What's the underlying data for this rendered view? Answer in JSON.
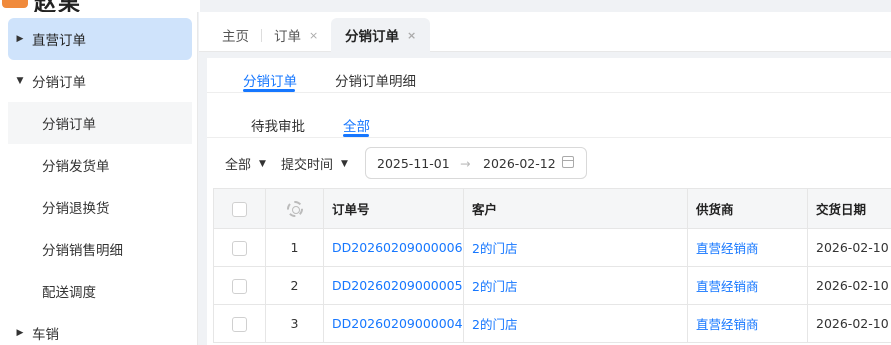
{
  "logo": {
    "text": "赵果"
  },
  "sidebar": {
    "items": [
      {
        "label": "直营订单"
      },
      {
        "label": "分销订单"
      },
      {
        "label": "分销订单"
      },
      {
        "label": "分销发货单"
      },
      {
        "label": "分销退换货"
      },
      {
        "label": "分销销售明细"
      },
      {
        "label": "配送调度"
      },
      {
        "label": "车销"
      }
    ]
  },
  "tabs": {
    "home": "主页",
    "orders": "订单",
    "dist_orders": "分销订单",
    "close": "×"
  },
  "subtabs": {
    "dist_orders": "分销订单",
    "dist_order_detail": "分销订单明细"
  },
  "status_tabs": {
    "pending": "待我审批",
    "all": "全部"
  },
  "filters": {
    "scope": "全部",
    "time_field": "提交时间",
    "date_start": "2025-11-01",
    "date_sep": "→",
    "date_end": "2026-02-12"
  },
  "table": {
    "columns": [
      "订单号",
      "客户",
      "供货商",
      "交货日期"
    ],
    "rows": [
      {
        "index": "1",
        "order_no": "DD20260209000006",
        "customer": "2的门店",
        "supplier": "直营经销商",
        "delivery_date": "2026-02-10"
      },
      {
        "index": "2",
        "order_no": "DD20260209000005",
        "customer": "2的门店",
        "supplier": "直营经销商",
        "delivery_date": "2026-02-10"
      },
      {
        "index": "3",
        "order_no": "DD20260209000004",
        "customer": "2的门店",
        "supplier": "直营经销商",
        "delivery_date": "2026-02-10"
      }
    ]
  },
  "colors": {
    "accent": "#1677ff",
    "sidebar_active": "#cfe3fb"
  }
}
